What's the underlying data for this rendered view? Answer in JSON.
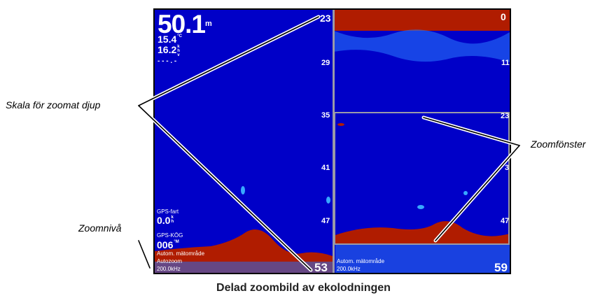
{
  "screen": {
    "depth_value": "50.1",
    "depth_unit": "m",
    "temp_value": "15.4",
    "temp_unit": "°C",
    "voltage_value": "16.2",
    "voltage_unit": "k h v",
    "speed_dashes": "- - - . -",
    "gps_speed_label": "GPS-fart",
    "gps_speed_value": "0.0",
    "gps_speed_unit": "k h",
    "gps_cog_label": "GPS-KÖG",
    "gps_cog_value": "006",
    "gps_cog_unit": "°M",
    "left_range_mode": "Autom. mätområde",
    "left_zoom_mode": "Autozoom",
    "left_frequency": "200.0kHz",
    "right_range_mode": "Autom. mätområde",
    "right_frequency": "200.0kHz",
    "left_scale": [
      "23",
      "29",
      "35",
      "41",
      "47",
      "53"
    ],
    "right_scale_top": [
      "0",
      "11"
    ],
    "right_zoom_scale": [
      "23",
      "3",
      "47"
    ],
    "right_bottom_depth": "59"
  },
  "callouts": {
    "zoom_scale": "Skala för zoomat djup",
    "zoom_window": "Zoomfönster",
    "zoom_level": "Zoomnivå"
  },
  "caption": "Delad zoombild av ekolodningen",
  "colors": {
    "water": "#0000c8",
    "bottom": "#b01c00",
    "clutter": "#38a8ff",
    "frame": "#9a9aa8"
  }
}
